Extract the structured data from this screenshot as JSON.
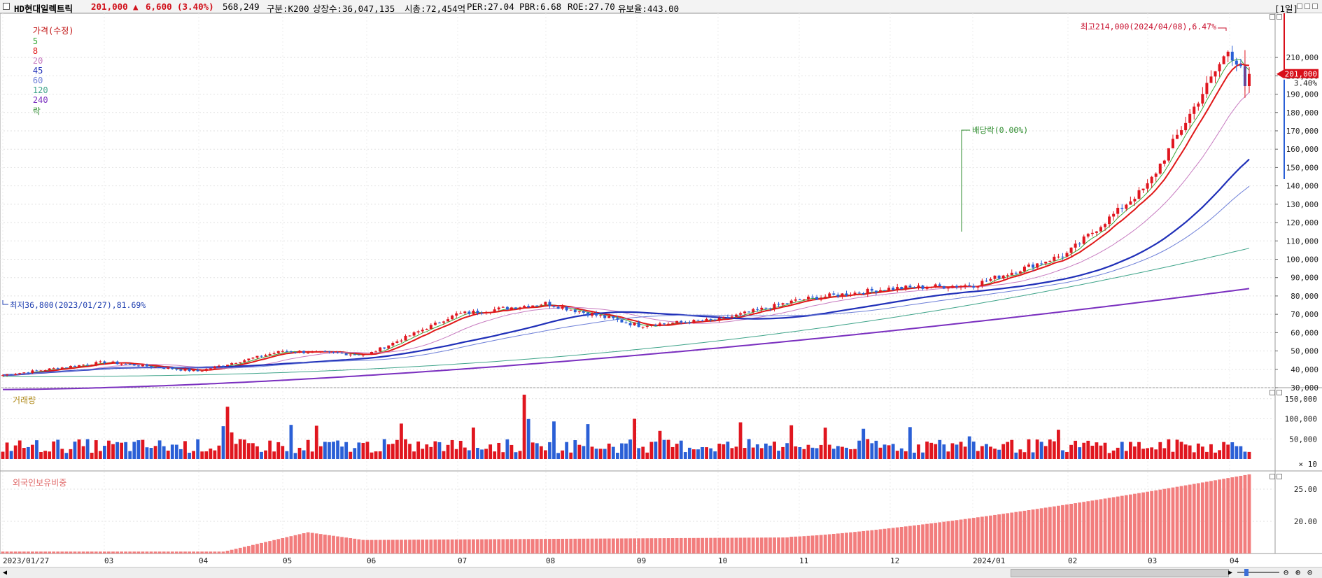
{
  "header": {
    "stock_name": "HD현대일렉트릭",
    "price": "201,000",
    "change_arrow": "▲",
    "change": "6,600",
    "change_pct": "(3.40%)",
    "volume": "568,249",
    "category": "구분:K200",
    "listed_shares": "상장수:36,047,135",
    "market_cap": "시총:72,454억",
    "per": "PER:27.04",
    "pbr": "PBR:6.68",
    "roe": "ROE:27.70",
    "float_ratio": "유보율:443.00",
    "timeframe": "[1일]"
  },
  "price_legend": {
    "price": "가격(수정)",
    "ma5": "5",
    "ma8": "8",
    "ma20": "20",
    "ma45": "45",
    "ma60": "60",
    "ma120": "120",
    "ma240": "240",
    "ex": "락"
  },
  "colors": {
    "up": "#e0161f",
    "down": "#2a5fd6",
    "ma5": "#39a839",
    "ma8": "#e01818",
    "ma20": "#c77bc0",
    "ma45": "#1f2fb8",
    "ma60": "#6d7fd8",
    "ma120": "#3fa48a",
    "ma240": "#7a2fbf",
    "foreign": "#f27d7d"
  },
  "annotations": {
    "high": "최고214,000(2024/04/08),6.47%",
    "low": "최저36,800(2023/01/27),81.69%",
    "dividend": "배당락(0.00%)"
  },
  "price_axis": {
    "ticks": [
      "210,000",
      "200,000",
      "190,000",
      "180,000",
      "170,000",
      "160,000",
      "150,000",
      "140,000",
      "130,000",
      "120,000",
      "110,000",
      "100,000",
      "90,000",
      "80,000",
      "70,000",
      "60,000",
      "50,000",
      "40,000",
      "30,000"
    ],
    "current": "201,000",
    "current_pct": "3.40%"
  },
  "volume_panel": {
    "title": "거래량",
    "ticks": [
      "150,000",
      "100,000",
      "50,000"
    ],
    "unit": "× 10"
  },
  "foreign_panel": {
    "title": "외국인보유비중",
    "ticks": [
      "25.00",
      "20.00"
    ]
  },
  "x_axis": {
    "labels": [
      "2023/01/27",
      "03",
      "04",
      "05",
      "06",
      "07",
      "08",
      "09",
      "10",
      "11",
      "12",
      "2024/01",
      "02",
      "03",
      "04"
    ]
  },
  "chart_data": {
    "type": "candlestick",
    "title": "HD현대일렉트릭",
    "x_range": [
      "2023/01/27",
      "2024/04/09"
    ],
    "y_range_price": [
      30000,
      215000
    ],
    "key_points": [
      {
        "date": "2023/01/27",
        "price": 36800,
        "label": "최저"
      },
      {
        "date": "2023/03",
        "price": 44000
      },
      {
        "date": "2023/04",
        "price": 39000
      },
      {
        "date": "2023/05",
        "price": 50000
      },
      {
        "date": "2023/06",
        "price": 48000
      },
      {
        "date": "2023/07",
        "price": 70000
      },
      {
        "date": "2023/08",
        "price": 76000
      },
      {
        "date": "2023/09",
        "price": 64000
      },
      {
        "date": "2023/10",
        "price": 67000
      },
      {
        "date": "2023/11",
        "price": 78000
      },
      {
        "date": "2023/12",
        "price": 84000
      },
      {
        "date": "2024/01",
        "price": 86000
      },
      {
        "date": "2024/02",
        "price": 103000
      },
      {
        "date": "2024/03",
        "price": 140000
      },
      {
        "date": "2024/04/08",
        "price": 214000,
        "label": "최고"
      },
      {
        "date": "2024/04/09",
        "price": 201000
      }
    ],
    "volume_max": 160000,
    "foreign_ratio_range": [
      15,
      27.5
    ]
  }
}
